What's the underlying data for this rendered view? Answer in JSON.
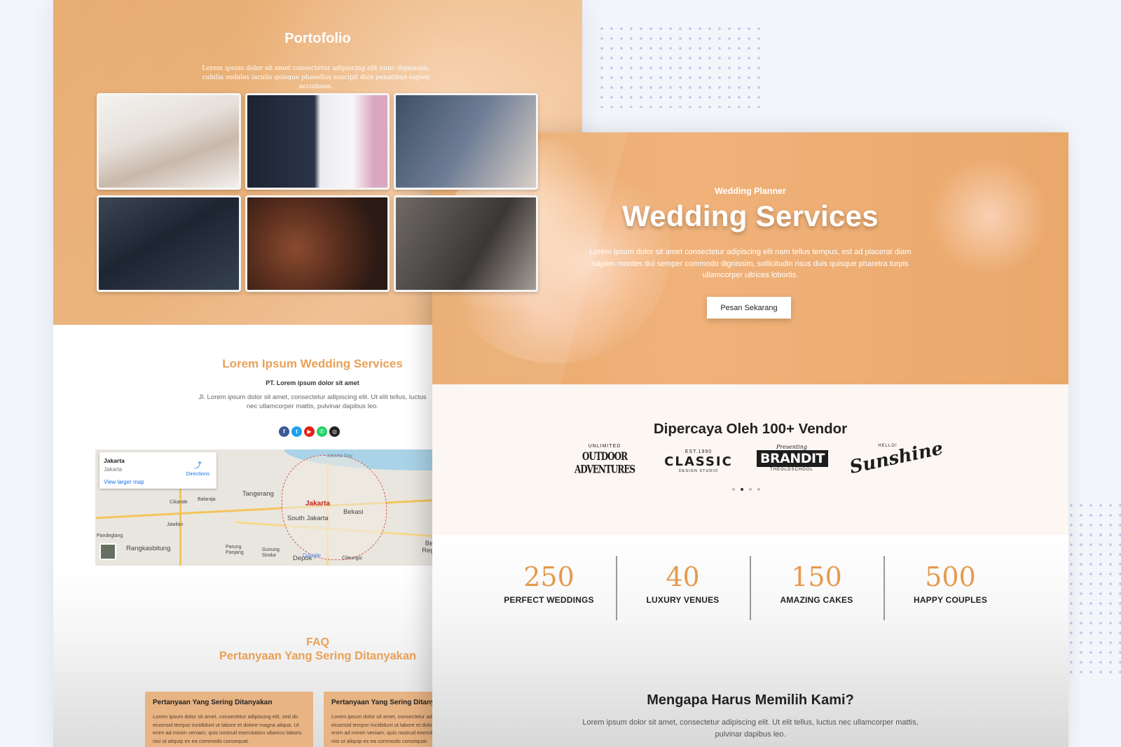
{
  "back_page": {
    "portfolio": {
      "title": "Portofolio",
      "description": "Lorem ipsum dolor sit amet consectetur adipiscing elit nunc dignissim, cubilia sodales iaculis quisque phasellus suscipit duis penatibus sapien accumsan."
    },
    "contact": {
      "title": "Lorem Ipsum Wedding Services",
      "company": "PT. Lorem ipsum dolor sit amet",
      "address": "Jl. Lorem ipsum dolor sit amet, consectetur adipiscing elit. Ut elit tellus, luctus nec ullamcorper mattis, pulvinar dapibus leo.",
      "map": {
        "card_title": "Jakarta",
        "card_subtitle": "Jakarta",
        "view_larger": "View larger map",
        "directions": "Directions",
        "labels": {
          "tangerang": "Tangerang",
          "jakarta": "Jakarta",
          "bekasi": "Bekasi",
          "south_jakarta": "South Jakarta",
          "rangkasbitung": "Rangkasbitung",
          "depok": "Depok",
          "bekasi_regency": "Bekasi Regency",
          "cikande": "Cikande",
          "balaraja": "Balaraja",
          "pandeglang": "Pandeglang",
          "cileungsi": "Cileungsi",
          "jawilan": "Jawilan",
          "parung_panjang": "Parung Panjang",
          "gunung_sindur": "Gunung Sindur",
          "jakarta_bay": "Jakarta Bay",
          "google": "Google"
        }
      }
    },
    "faq": {
      "kicker": "FAQ",
      "title": "Pertanyaan Yang Sering Ditanyakan",
      "cards": [
        {
          "question": "Pertanyaan Yang Sering Ditanyakan",
          "answer": "Lorem ipsum dolor sit amet, consectetur adipiscing elit, sed do eiusmod tempor incididunt ut labore et dolore magna aliqua. Ut enim ad minim veniam, quis nostrud exercitation ullamco laboris nisi ut aliquip ex ea commodo consequat."
        },
        {
          "question": "Pertanyaan Yang Sering Ditanyakan",
          "answer": "Lorem ipsum dolor sit amet, consectetur adipiscing elit, sed do eiusmod tempor incididunt ut labore et dolore magna aliqua. Ut enim ad minim veniam, quis nostrud exercitation ullamco laboris nisi ut aliquip ex ea commodo consequat."
        }
      ]
    }
  },
  "front_page": {
    "hero": {
      "kicker": "Wedding Planner",
      "title": "Wedding Services",
      "description": "Lorem ipsum dolor sit amet consectetur adipiscing elit nam tellus tempus, est ad placerat diam sapien montes dui semper commodo dignissim, sollicitudin risus duis quisque pharetra turpis ullamcorper ultrices lobortis.",
      "button": "Pesan Sekarang"
    },
    "vendors": {
      "title": "Dipercaya Oleh 100+ Vendor",
      "logos": [
        {
          "small": "UNLIMITED",
          "name": "OUTDOOR ADVENTURES"
        },
        {
          "small": "EST.1990",
          "name": "CLASSIC",
          "sub": "DESIGN STUDIO"
        },
        {
          "small": "Presenting",
          "name": "BRANDIT",
          "sub": "THEOLDSCHOOL"
        },
        {
          "small": "HELLO!",
          "name": "Sunshine"
        }
      ]
    },
    "stats": [
      {
        "value": "250",
        "label": "PERFECT WEDDINGS"
      },
      {
        "value": "40",
        "label": "LUXURY VENUES"
      },
      {
        "value": "150",
        "label": "AMAZING CAKES"
      },
      {
        "value": "500",
        "label": "HAPPY COUPLES"
      }
    ],
    "why": {
      "title": "Mengapa Harus Memilih Kami?",
      "description": "Lorem ipsum dolor sit amet, consectetur adipiscing elit. Ut elit tellus, luctus nec ullamcorper mattis, pulvinar dapibus leo."
    }
  },
  "colors": {
    "accent": "#e9a057",
    "hero_orange": "#f0b27a",
    "stat_number": "#e59a4e"
  },
  "icons": [
    "facebook-icon",
    "twitter-icon",
    "youtube-icon",
    "whatsapp-icon",
    "instagram-icon",
    "directions-icon"
  ]
}
